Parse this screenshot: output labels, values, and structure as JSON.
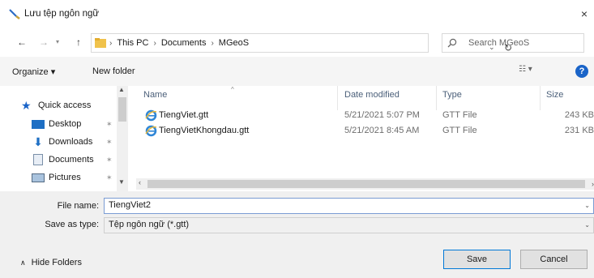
{
  "window": {
    "title": "Lưu tệp ngôn ngữ",
    "close_glyph": "×"
  },
  "address": {
    "crumbs": [
      "This PC",
      "Documents",
      "MGeoS"
    ],
    "search_placeholder": "Search MGeoS"
  },
  "toolbar": {
    "organize_label": "Organize ▾",
    "new_folder_label": "New folder",
    "help_glyph": "?"
  },
  "navpane": {
    "items": [
      {
        "label": "Quick access",
        "icon": "star-icon",
        "pinned": false
      },
      {
        "label": "Desktop",
        "icon": "desktop-icon",
        "pinned": true
      },
      {
        "label": "Downloads",
        "icon": "download-arrow-icon",
        "pinned": true
      },
      {
        "label": "Documents",
        "icon": "documents-icon",
        "pinned": true
      },
      {
        "label": "Pictures",
        "icon": "pictures-icon",
        "pinned": true
      }
    ]
  },
  "files": {
    "columns": {
      "name": "Name",
      "date": "Date modified",
      "type": "Type",
      "size": "Size"
    },
    "rows": [
      {
        "name": "TiengViet.gtt",
        "date": "5/21/2021 5:07 PM",
        "type": "GTT File",
        "size": "243 KB"
      },
      {
        "name": "TiengVietKhongdau.gtt",
        "date": "5/21/2021 8:45 AM",
        "type": "GTT File",
        "size": "231 KB"
      }
    ]
  },
  "save": {
    "file_name_label": "File name:",
    "file_name_value": "TiengViet2",
    "save_as_type_label": "Save as type:",
    "save_as_type_value": "Tệp ngôn ngữ (*.gtt)",
    "hide_folders_label": "Hide Folders",
    "save_button": "Save",
    "cancel_button": "Cancel"
  },
  "colors": {
    "accent": "#0078d7",
    "help_blue": "#1a64c8",
    "folder_yellow": "#f0c24b"
  }
}
